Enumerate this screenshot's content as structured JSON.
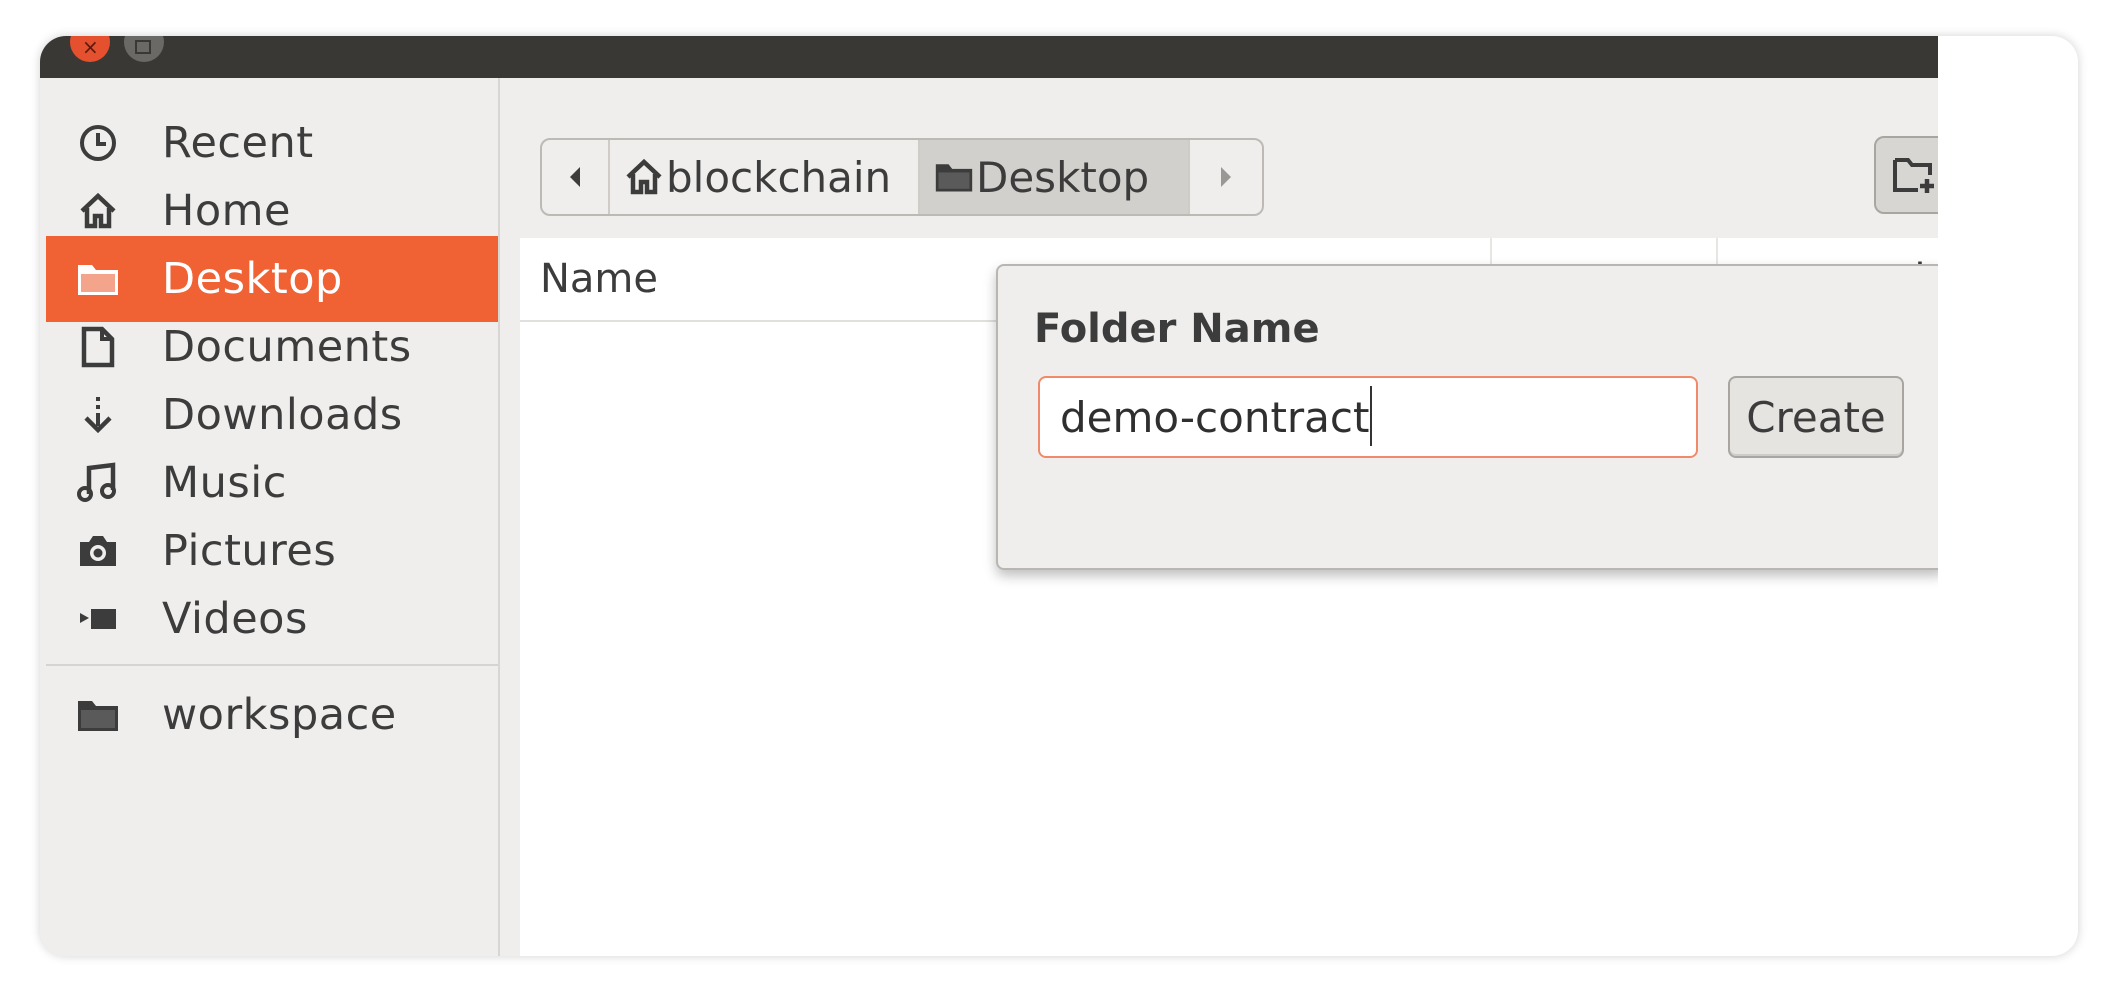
{
  "sidebar": {
    "items": [
      {
        "label": "Recent",
        "icon": "clock-icon"
      },
      {
        "label": "Home",
        "icon": "home-icon"
      },
      {
        "label": "Desktop",
        "icon": "folder-icon",
        "active": true
      },
      {
        "label": "Documents",
        "icon": "document-icon"
      },
      {
        "label": "Downloads",
        "icon": "download-icon"
      },
      {
        "label": "Music",
        "icon": "music-icon"
      },
      {
        "label": "Pictures",
        "icon": "camera-icon"
      },
      {
        "label": "Videos",
        "icon": "video-icon"
      }
    ],
    "bookmarks": [
      {
        "label": "workspace",
        "icon": "folder-icon"
      }
    ],
    "active_color": "#f06133"
  },
  "pathbar": {
    "segments": [
      {
        "label": "blockchain",
        "icon": "home-icon"
      },
      {
        "label": "Desktop",
        "icon": "folder-icon",
        "active": true
      }
    ]
  },
  "toolbar": {
    "new_folder_icon": "new-folder-icon"
  },
  "list": {
    "columns": {
      "name": "Name",
      "partial": "d"
    }
  },
  "popover": {
    "title": "Folder Name",
    "input_value": "demo-contract",
    "create_label": "Create"
  }
}
